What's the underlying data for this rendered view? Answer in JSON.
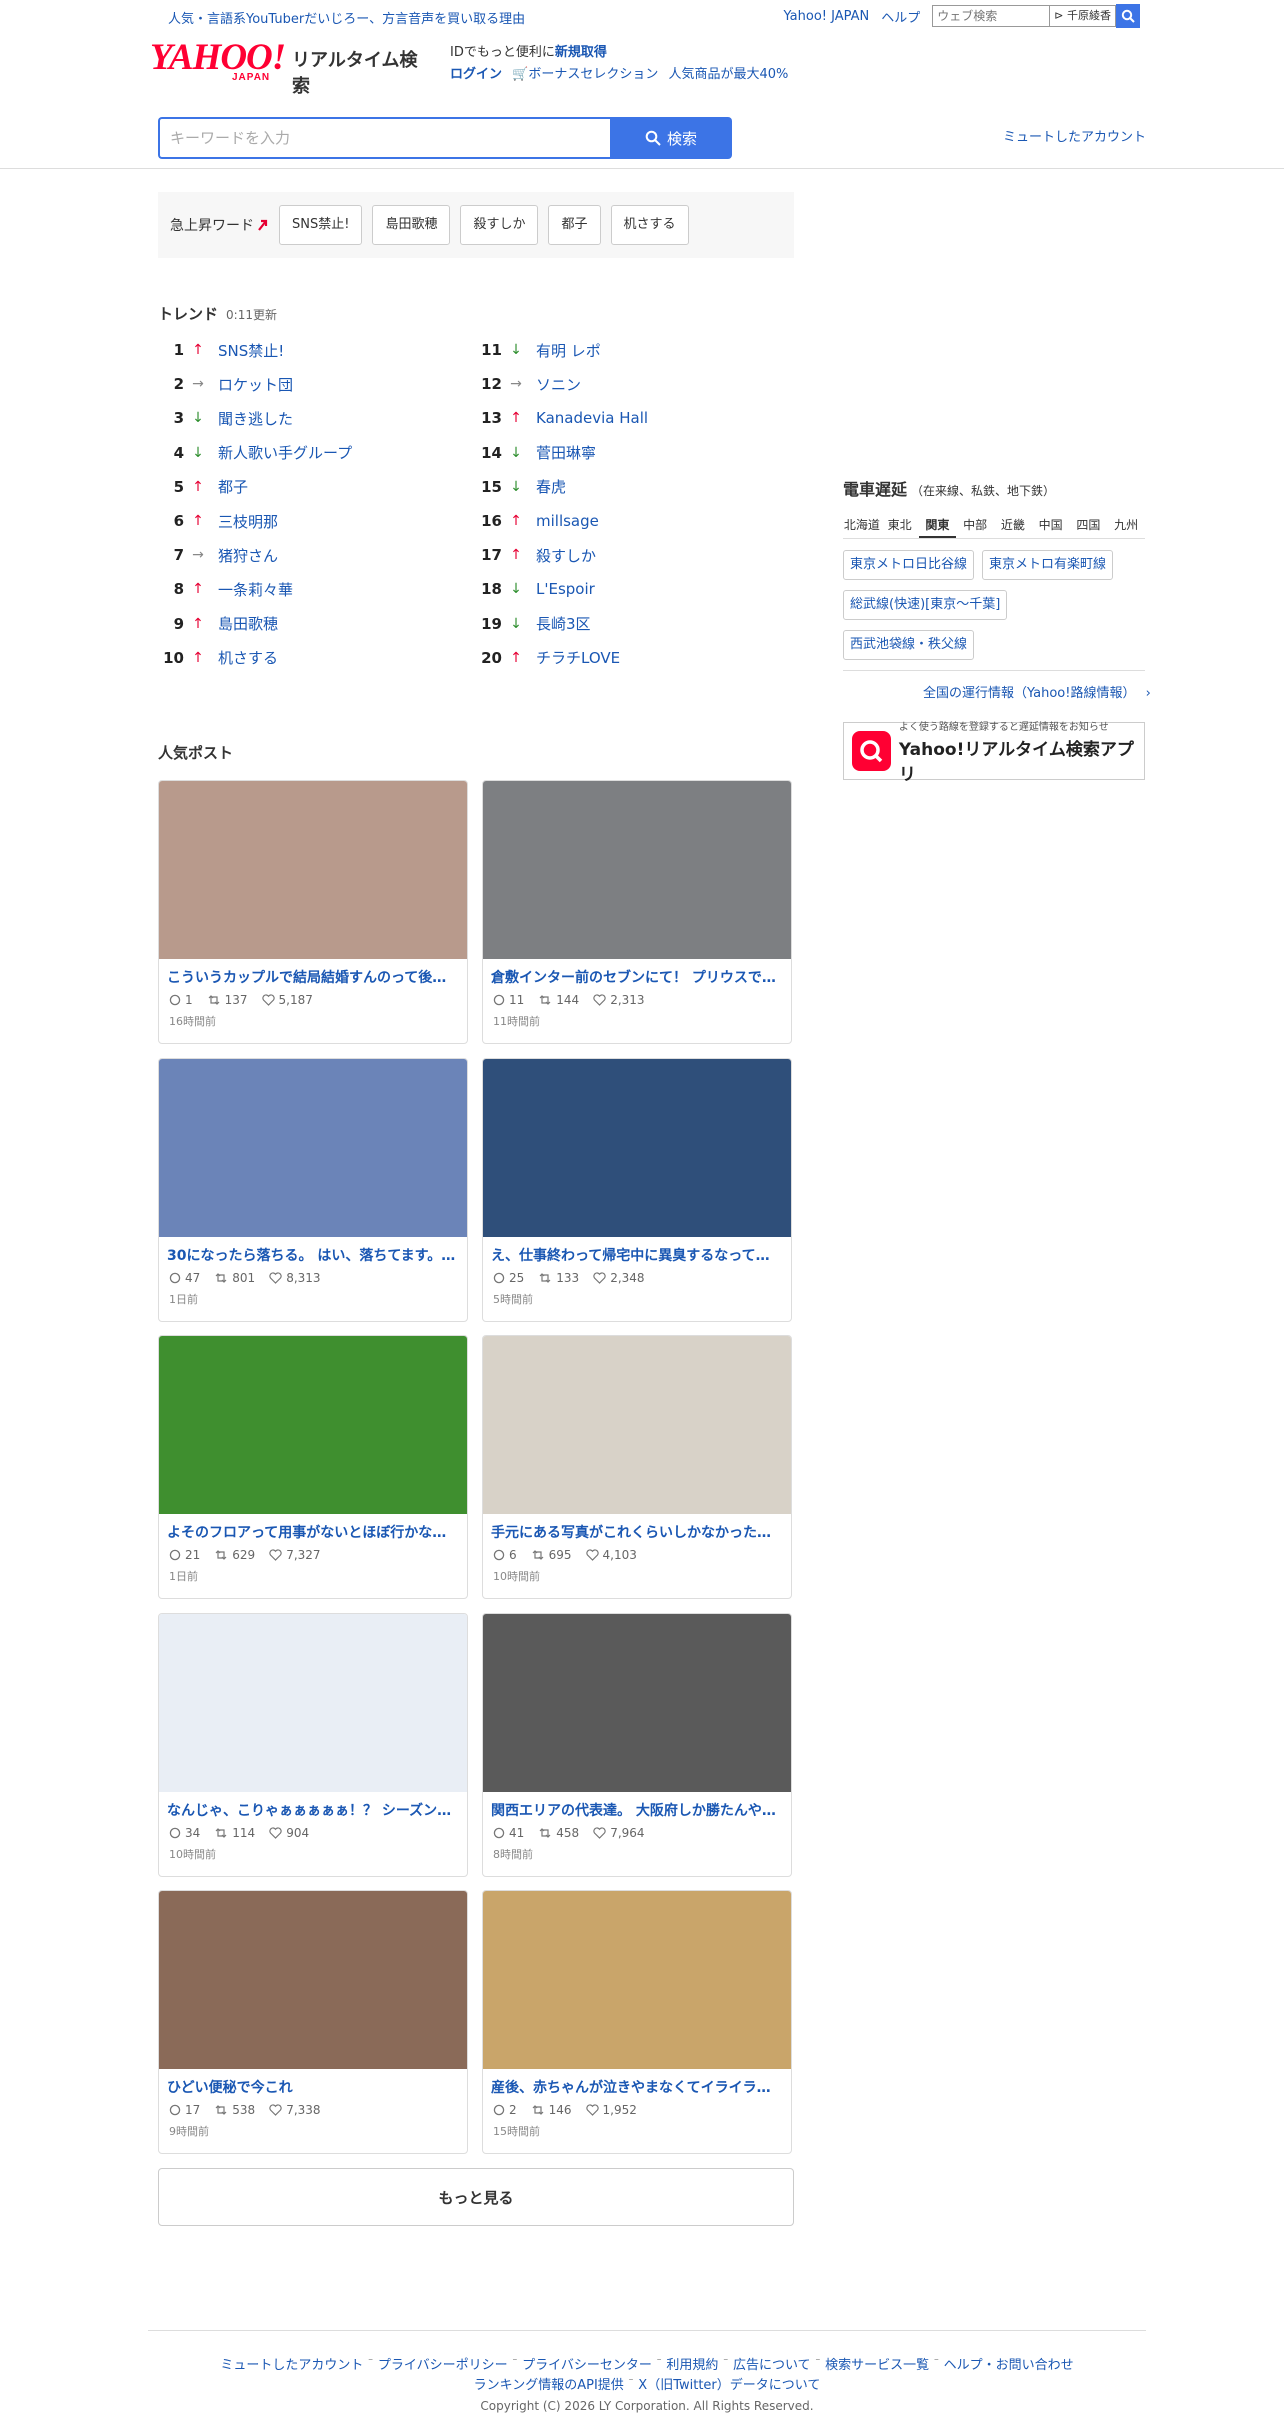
{
  "topbar": {
    "news_link": "人気・言語系YouTuberだいじろー、方言音声を買い取る理由",
    "yahoo_japan": "Yahoo! JAPAN",
    "help": "ヘルプ",
    "web_search_placeholder": "ウェブ検索",
    "web_search_suggest": "千原綾香"
  },
  "header": {
    "logo_yahoo": "YAHOO!",
    "logo_japan": "JAPAN",
    "logo_sub": "リアルタイム検索",
    "id_promo_text": "IDでもっと便利に",
    "id_promo_link": "新規取得",
    "login": "ログイン",
    "bonus": "ボーナスセレクション",
    "bonus_desc": "人気商品が最大40%",
    "search_placeholder": "キーワードを入力",
    "search_button": "検索",
    "muted_accounts": "ミュートしたアカウント"
  },
  "rising": {
    "label": "急上昇ワード",
    "words": [
      "SNS禁止!",
      "島田歌穂",
      "殺すしか",
      "都子",
      "机さする"
    ]
  },
  "trend": {
    "title": "トレンド",
    "updated": "0:11更新",
    "items": [
      {
        "rank": "1",
        "dir": "up",
        "word": "SNS禁止!"
      },
      {
        "rank": "2",
        "dir": "flat",
        "word": "ロケット団"
      },
      {
        "rank": "3",
        "dir": "down",
        "word": "聞き逃した"
      },
      {
        "rank": "4",
        "dir": "down",
        "word": "新人歌い手グループ"
      },
      {
        "rank": "5",
        "dir": "up",
        "word": "都子"
      },
      {
        "rank": "6",
        "dir": "up",
        "word": "三枝明那"
      },
      {
        "rank": "7",
        "dir": "flat",
        "word": "猪狩さん"
      },
      {
        "rank": "8",
        "dir": "up",
        "word": "一条莉々華"
      },
      {
        "rank": "9",
        "dir": "up",
        "word": "島田歌穂"
      },
      {
        "rank": "10",
        "dir": "up",
        "word": "机さする"
      },
      {
        "rank": "11",
        "dir": "down",
        "word": "有明 レポ"
      },
      {
        "rank": "12",
        "dir": "flat",
        "word": "ソニン"
      },
      {
        "rank": "13",
        "dir": "up",
        "word": "Kanadevia Hall"
      },
      {
        "rank": "14",
        "dir": "down",
        "word": "菅田琳寧"
      },
      {
        "rank": "15",
        "dir": "down",
        "word": "春虎"
      },
      {
        "rank": "16",
        "dir": "up",
        "word": "millsage"
      },
      {
        "rank": "17",
        "dir": "up",
        "word": "殺すしか"
      },
      {
        "rank": "18",
        "dir": "down",
        "word": "L'Espoir"
      },
      {
        "rank": "19",
        "dir": "down",
        "word": "長崎3区"
      },
      {
        "rank": "20",
        "dir": "up",
        "word": "チラチLOVE"
      }
    ]
  },
  "posts": {
    "title": "人気ポスト",
    "items": [
      {
        "title": "こういうカップルで結局結婚すんのって後…",
        "replies": "1",
        "reposts": "137",
        "likes": "5,187",
        "time": "16時間前",
        "color": "#b89a8c"
      },
      {
        "title": "倉敷インター前のセブンにて！ プリウスで…",
        "replies": "11",
        "reposts": "144",
        "likes": "2,313",
        "time": "11時間前",
        "color": "#7d7f82"
      },
      {
        "title": "30になったら落ちる。 はい、落ちてます。…",
        "replies": "47",
        "reposts": "801",
        "likes": "8,313",
        "time": "1日前",
        "color": "#6b84b8"
      },
      {
        "title": "え、仕事終わって帰宅中に異臭するなって…",
        "replies": "25",
        "reposts": "133",
        "likes": "2,348",
        "time": "5時間前",
        "color": "#2f4f7a"
      },
      {
        "title": "よそのフロアって用事がないとほぼ行かな…",
        "replies": "21",
        "reposts": "629",
        "likes": "7,327",
        "time": "1日前",
        "color": "#3f8f2f"
      },
      {
        "title": "手元にある写真がこれくらいしかなかった…",
        "replies": "6",
        "reposts": "695",
        "likes": "4,103",
        "time": "10時間前",
        "color": "#d8d2c8"
      },
      {
        "title": "なんじゃ、こりゃぁぁぁぁぁ！？ シーズン…",
        "replies": "34",
        "reposts": "114",
        "likes": "904",
        "time": "10時間前",
        "color": "#e9eef5"
      },
      {
        "title": "関西エリアの代表達。 大阪府しか勝たんや…",
        "replies": "41",
        "reposts": "458",
        "likes": "7,964",
        "time": "8時間前",
        "color": "#5a5a5a"
      },
      {
        "title": "ひどい便秘で今これ",
        "replies": "17",
        "reposts": "538",
        "likes": "7,338",
        "time": "9時間前",
        "color": "#8a6a58"
      },
      {
        "title": "産後、赤ちゃんが泣きやまなくてイライラ…",
        "replies": "2",
        "reposts": "146",
        "likes": "1,952",
        "time": "15時間前",
        "color": "#c9a56a"
      }
    ],
    "more": "もっと見る"
  },
  "sidebar": {
    "train_title": "電車遅延",
    "train_sub": "（在来線、私鉄、地下鉄）",
    "regions": [
      "北海道",
      "東北",
      "関東",
      "中部",
      "近畿",
      "中国",
      "四国",
      "九州"
    ],
    "active_region": "関東",
    "lines": [
      "東京メトロ日比谷線",
      "東京メトロ有楽町線",
      "総武線(快速)[東京～千葉]",
      "西武池袋線・秩父線"
    ],
    "all_lines": "全国の運行情報（Yahoo!路線情報）",
    "app_small": "よく使う路線を登録すると遅延情報をお知らせ",
    "app_name": "Yahoo!リアルタイム検索アプリ"
  },
  "footer": {
    "links": [
      "ミュートしたアカウント",
      "プライバシーポリシー",
      "プライバシーセンター",
      "利用規約",
      "広告について",
      "検索サービス一覧",
      "ヘルプ・お問い合わせ"
    ],
    "api_link": "ランキング情報のAPI提供",
    "x_data": "X（旧Twitter）データについて",
    "copyright": "Copyright (C) 2026 LY Corporation. All Rights Reserved."
  },
  "colors": {
    "accent": "#3c74e6",
    "link": "#1a57b3",
    "up": "#e60033",
    "down": "#2f8f2f",
    "brand": "#ff0033"
  }
}
